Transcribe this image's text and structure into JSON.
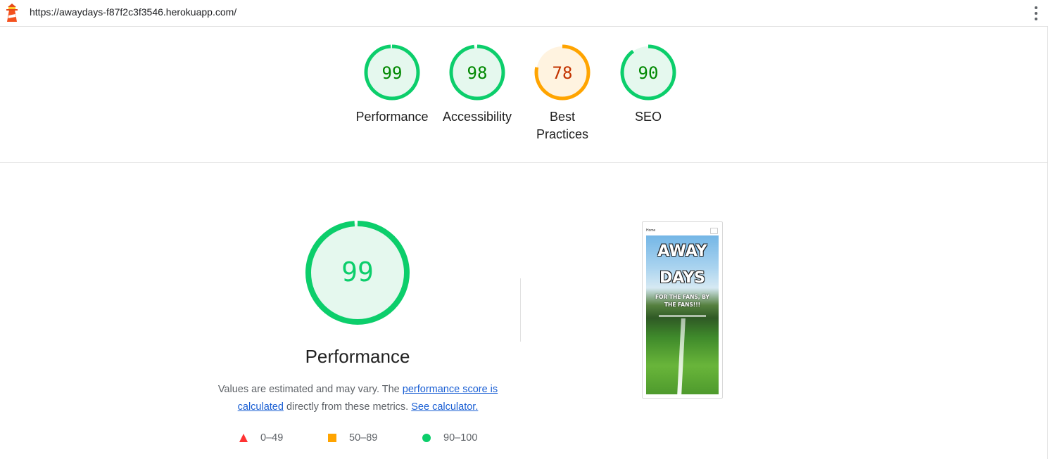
{
  "header": {
    "url": "https://awaydays-f87f2c3f3546.herokuapp.com/"
  },
  "colors": {
    "pass": "#0cce6b",
    "pass_text": "#008800",
    "pass_bg": "#e5f8ee",
    "average": "#ffa400",
    "average_text": "#c33300",
    "average_bg": "#fff3e0",
    "fail": "#ff3333"
  },
  "gauges": [
    {
      "score": "99",
      "label": "Performance",
      "rating": "pass"
    },
    {
      "score": "98",
      "label": "Accessibility",
      "rating": "pass"
    },
    {
      "score": "78",
      "label": "Best Practices",
      "rating": "average"
    },
    {
      "score": "90",
      "label": "SEO",
      "rating": "pass"
    }
  ],
  "performance": {
    "score": "99",
    "title": "Performance",
    "desc_prefix": "Values are estimated and may vary. The ",
    "desc_link1": "performance score is calculated",
    "desc_middle": " directly from these metrics. ",
    "desc_link2": "See calculator."
  },
  "legend": [
    {
      "range": "0–49",
      "shape": "triangle"
    },
    {
      "range": "50–89",
      "shape": "square"
    },
    {
      "range": "90–100",
      "shape": "circle"
    }
  ],
  "screenshot": {
    "nav_home": "Home",
    "title_line1": "AWAY",
    "title_line2": "DAYS",
    "subtitle": "FOR THE FANS, BY THE FANS!!!"
  }
}
